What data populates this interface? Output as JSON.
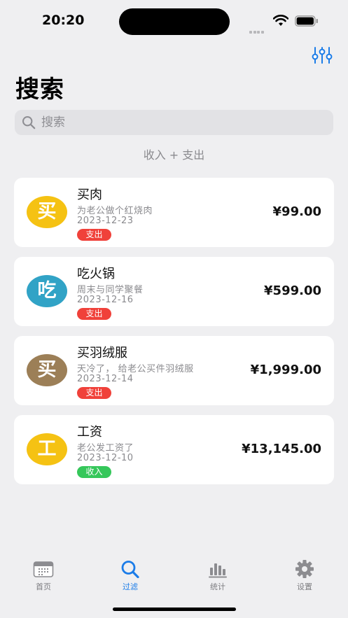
{
  "status_bar": {
    "time": "20:20"
  },
  "header": {
    "title": "搜索",
    "filter_icon": "sliders-icon"
  },
  "search": {
    "placeholder": "搜索",
    "value": ""
  },
  "filter_label": "收入 + 支出",
  "transactions": [
    {
      "avatar_char": "买",
      "avatar_color": "#f5c213",
      "title": "买肉",
      "note": "为老公做个红烧肉",
      "date": "2023-12-23",
      "tag": "支出",
      "tag_color": "#f0413a",
      "amount": "¥99.00"
    },
    {
      "avatar_char": "吃",
      "avatar_color": "#31a3c6",
      "title": "吃火锅",
      "note": "周末与同学聚餐",
      "date": "2023-12-16",
      "tag": "支出",
      "tag_color": "#f0413a",
      "amount": "¥599.00"
    },
    {
      "avatar_char": "买",
      "avatar_color": "#9c7f57",
      "title": "买羽绒服",
      "note": "天冷了， 给老公买件羽绒服",
      "date": "2023-12-14",
      "tag": "支出",
      "tag_color": "#f0413a",
      "amount": "¥1,999.00"
    },
    {
      "avatar_char": "工",
      "avatar_color": "#f5c213",
      "title": "工资",
      "note": "老公发工资了",
      "date": "2023-12-10",
      "tag": "收入",
      "tag_color": "#35c75a",
      "amount": "¥13,145.00"
    }
  ],
  "tabs": [
    {
      "label": "首页",
      "icon": "calendar-icon",
      "active": false
    },
    {
      "label": "过滤",
      "icon": "search-icon",
      "active": true
    },
    {
      "label": "统计",
      "icon": "bar-chart-icon",
      "active": false
    },
    {
      "label": "设置",
      "icon": "gear-icon",
      "active": false
    }
  ],
  "colors": {
    "accent": "#1b7ce8",
    "expense": "#f0413a",
    "income": "#35c75a"
  }
}
